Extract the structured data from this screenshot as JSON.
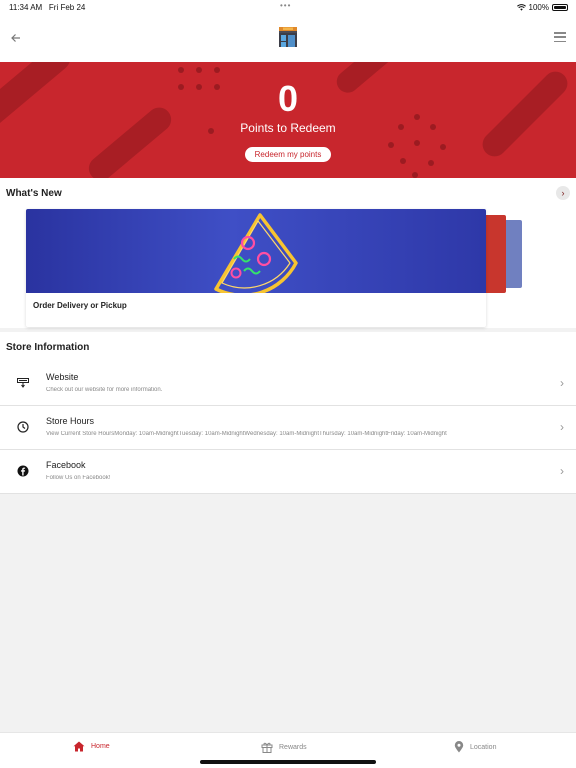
{
  "status_bar": {
    "time": "11:34 AM",
    "date": "Fri Feb 24",
    "battery": "100%"
  },
  "header": {
    "back_icon": "arrow-left-icon",
    "menu_icon": "hamburger-menu-icon",
    "logo_icon": "storefront-icon"
  },
  "hero": {
    "points": "0",
    "points_label": "Points to Redeem",
    "redeem_button": "Redeem my points",
    "background_color": "#c8262d"
  },
  "whats_new": {
    "title": "What's New",
    "next_icon": "chevron-right-icon",
    "cards": [
      {
        "label": "Order Delivery or Pickup",
        "image_icon": "neon-pizza-slice-icon"
      }
    ]
  },
  "store_information": {
    "title": "Store Information",
    "rows": [
      {
        "title": "Website",
        "subtitle": "Check out our website for more information.",
        "icon": "website-icon"
      },
      {
        "title": "Store Hours",
        "subtitle": "View Current Store HoursMonday: 10am-MidnightTuesday: 10am-MidnightWednesday: 10am-MidnightThursday: 10am-MidnightFriday: 10am-Midnight",
        "icon": "clock-icon"
      },
      {
        "title": "Facebook",
        "subtitle": "Follow Us on Facebook!",
        "icon": "facebook-icon"
      }
    ]
  },
  "tabbar": {
    "home": "Home",
    "rewards": "Rewards",
    "location": "Location",
    "active_color": "#c8262d"
  }
}
